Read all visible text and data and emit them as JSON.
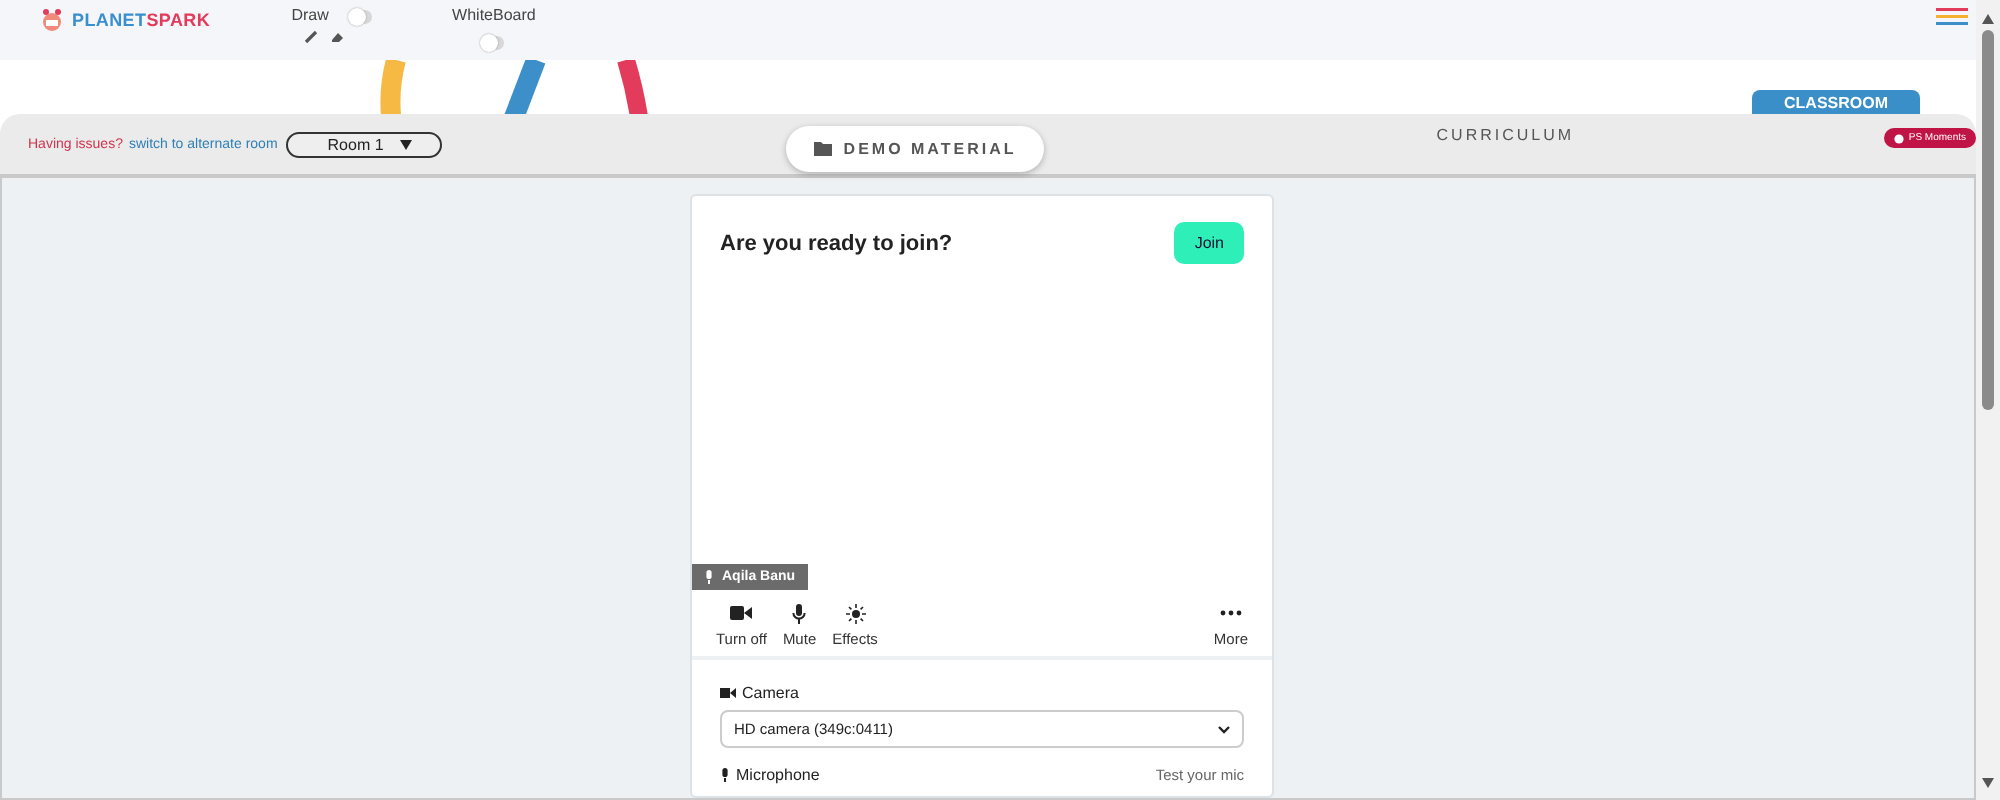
{
  "header": {
    "logo": {
      "part1": "PLANET",
      "part2": "SPARK"
    },
    "toggles": [
      {
        "label": "Draw",
        "on": false
      },
      {
        "label": "WhiteBoard",
        "on": false
      }
    ]
  },
  "room_bar": {
    "issue_text": "Having issues?",
    "link": "switch to alternate room",
    "room": "Room 1",
    "tabs": [
      {
        "label": "DEMO MATERIAL",
        "selected": true
      },
      {
        "label": "CURRICULUM",
        "selected": false
      }
    ],
    "classroom_tab": "CLASSROOM",
    "badge": "PS Moments"
  },
  "join_card": {
    "title": "Are you ready to join?",
    "join_button": "Join",
    "participant": "Aqila Banu",
    "controls": [
      {
        "kind": "camera",
        "label": "Turn off"
      },
      {
        "kind": "mic",
        "label": "Mute"
      },
      {
        "kind": "effects",
        "label": "Effects"
      },
      {
        "kind": "more",
        "label": "More"
      }
    ],
    "camera_label": "Camera",
    "camera_device": "HD camera (349c:0411)",
    "microphone_label": "Microphone",
    "test_mic": "Test your mic"
  }
}
